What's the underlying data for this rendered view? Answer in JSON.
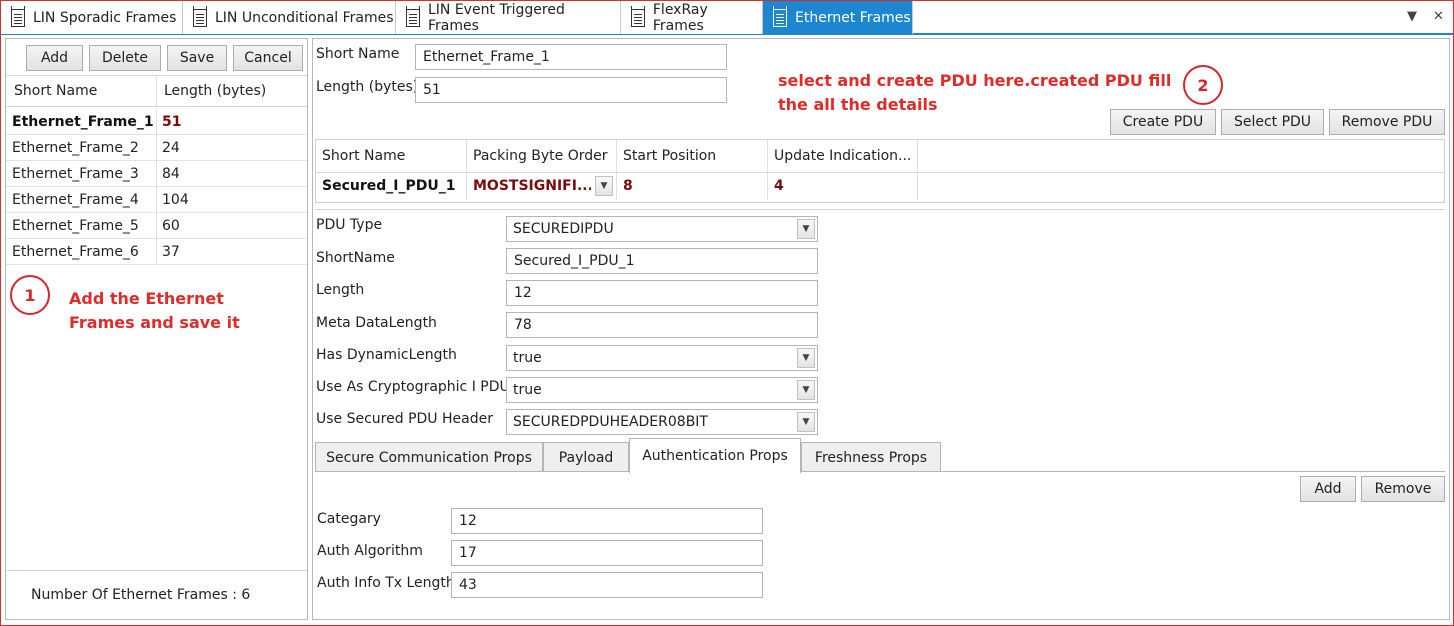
{
  "tabs": [
    {
      "label": "LIN Sporadic Frames",
      "active": false
    },
    {
      "label": "LIN Unconditional Frames",
      "active": false
    },
    {
      "label": "LIN Event Triggered Frames",
      "active": false
    },
    {
      "label": "FlexRay Frames",
      "active": false
    },
    {
      "label": "Ethernet Frames",
      "active": true
    }
  ],
  "tab_controls": {
    "dropdown_glyph": "▼",
    "close_glyph": "✕"
  },
  "left": {
    "buttons": {
      "add": "Add",
      "delete": "Delete",
      "save": "Save",
      "cancel": "Cancel"
    },
    "columns": [
      "Short Name",
      "Length (bytes)"
    ],
    "rows": [
      {
        "name": "Ethernet_Frame_1",
        "length": "51"
      },
      {
        "name": "Ethernet_Frame_2",
        "length": "24"
      },
      {
        "name": "Ethernet_Frame_3",
        "length": "84"
      },
      {
        "name": "Ethernet_Frame_4",
        "length": "104"
      },
      {
        "name": "Ethernet_Frame_5",
        "length": "60"
      },
      {
        "name": "Ethernet_Frame_6",
        "length": "37"
      }
    ],
    "note_number": "1",
    "note_line1": "Add the Ethernet",
    "note_line2": "Frames and save it",
    "footer": "Number Of Ethernet Frames : 6"
  },
  "right": {
    "short_name_label": "Short Name",
    "short_name_value": "Ethernet_Frame_1",
    "length_label": "Length (bytes)",
    "length_value": "51",
    "note_line1": "select and create PDU here.created PDU fill",
    "note_line2": "the all the details",
    "note_number": "2",
    "buttons": {
      "create_pdu": "Create PDU",
      "select_pdu": "Select PDU",
      "remove_pdu": "Remove PDU"
    },
    "pdu_columns": [
      "Short Name",
      "Packing Byte Order",
      "Start Position",
      "Update Indication..."
    ],
    "pdu_row": {
      "short_name": "Secured_I_PDU_1",
      "packing": "MOSTSIGNIFI...",
      "start": "8",
      "update": "4"
    },
    "fields": {
      "pdu_type_label": "PDU Type",
      "pdu_type_value": "SECUREDIPDU",
      "shortname_label": "ShortName",
      "shortname_value": "Secured_I_PDU_1",
      "length_label": "Length",
      "length_value": "12",
      "meta_label": "Meta DataLength",
      "meta_value": "78",
      "dynamic_label": "Has DynamicLength",
      "dynamic_value": "true",
      "crypto_label": "Use As Cryptographic I PDU",
      "crypto_value": "true",
      "header_label": "Use Secured PDU Header",
      "header_value": "SECUREDPDUHEADER08BIT"
    },
    "inner_tabs": [
      "Secure Communication Props",
      "Payload",
      "Authentication Props",
      "Freshness Props"
    ],
    "auth": {
      "add": "Add",
      "remove": "Remove",
      "category_label": "Categary",
      "category_value": "12",
      "algorithm_label": "Auth Algorithm",
      "algorithm_value": "17",
      "txlen_label": "Auth Info Tx Length",
      "txlen_value": "43"
    }
  }
}
